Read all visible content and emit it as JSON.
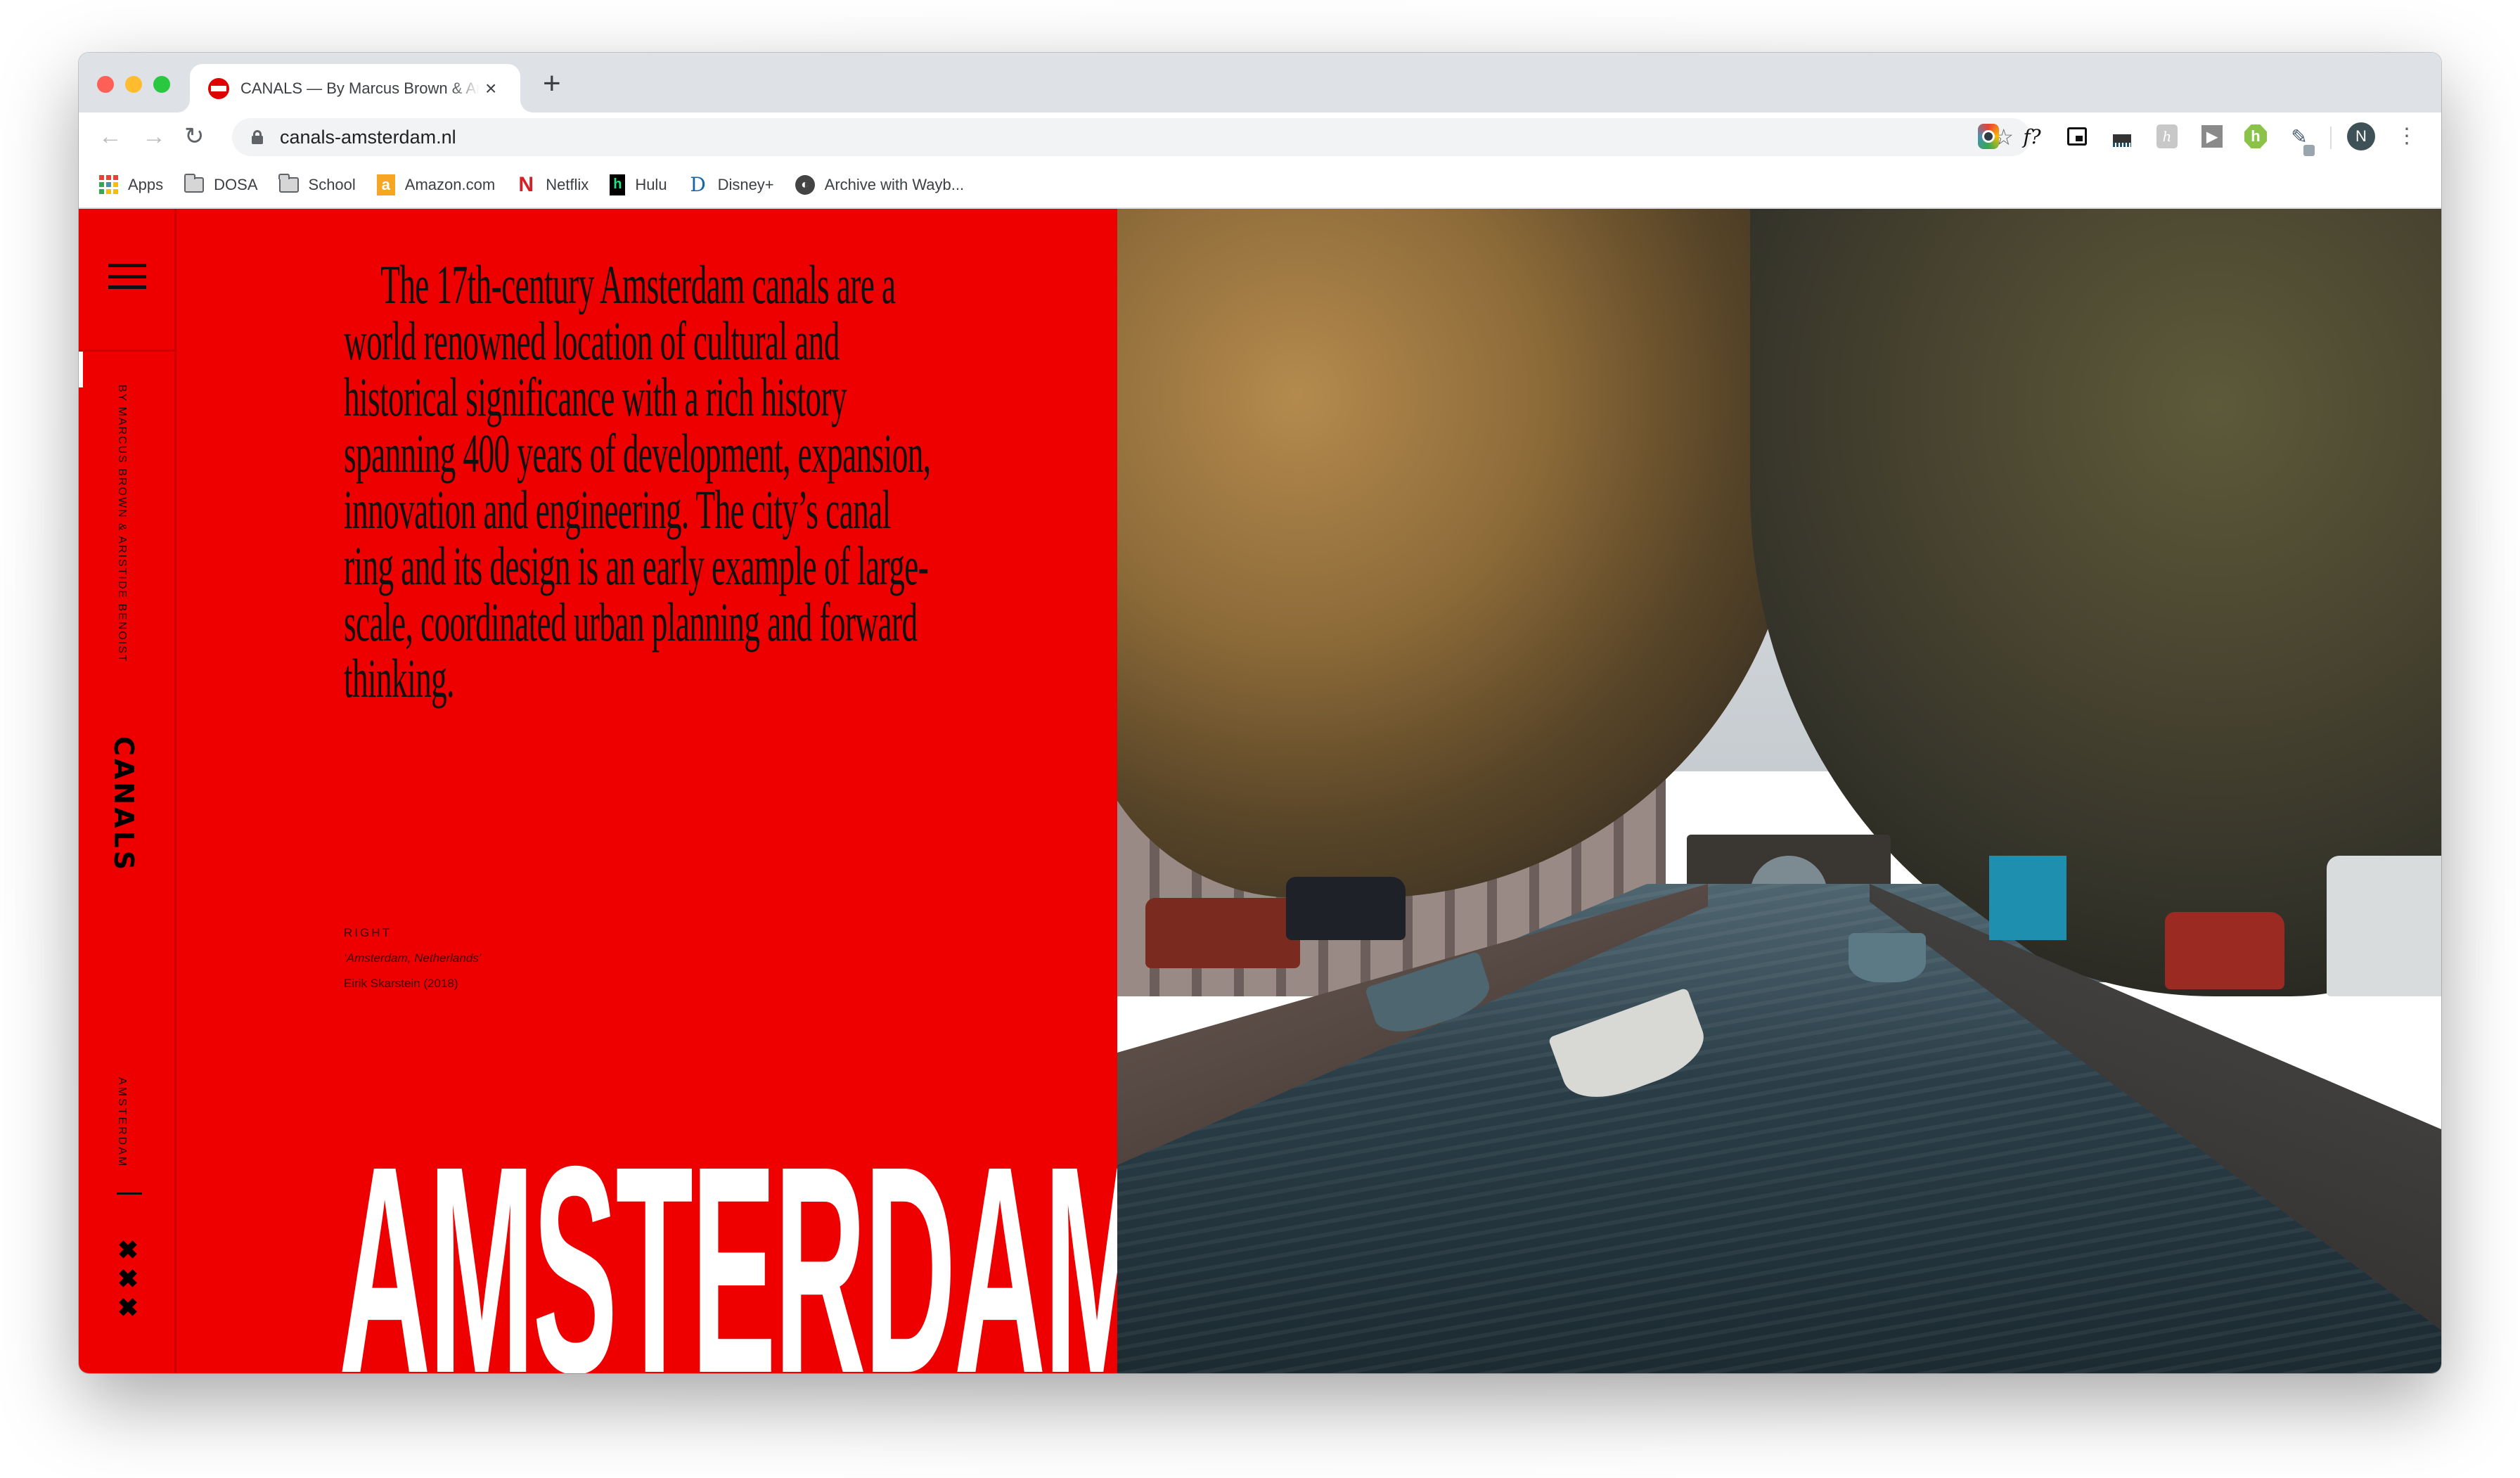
{
  "browser": {
    "tab": {
      "title": "CANALS — By Marcus Brown & Aristide Benoist",
      "close_label": "×"
    },
    "new_tab_label": "+",
    "nav": {
      "back_icon": "←",
      "forward_icon": "→",
      "reload_icon": "↻"
    },
    "address_bar": {
      "url": "canals-amsterdam.nl",
      "secure": true
    },
    "bookmark_star_icon": "☆",
    "extensions": [
      {
        "name": "camera-extension"
      },
      {
        "name": "formula-extension",
        "label": "f?"
      },
      {
        "name": "picture-in-picture-extension"
      },
      {
        "name": "code-extension"
      },
      {
        "name": "honey-extension",
        "label": "h"
      },
      {
        "name": "play-extension",
        "label": "▶"
      },
      {
        "name": "hover-extension",
        "label": "h"
      },
      {
        "name": "eyedropper-extension",
        "label": "✎"
      }
    ],
    "profile_initial": "N",
    "menu_icon": "⋮",
    "bookmarks": [
      {
        "label": "Apps",
        "icon": "apps-grid-icon"
      },
      {
        "label": "DOSA",
        "icon": "folder-icon"
      },
      {
        "label": "School",
        "icon": "folder-icon"
      },
      {
        "label": "Amazon.com",
        "icon": "amazon-icon",
        "glyph": "a"
      },
      {
        "label": "Netflix",
        "icon": "netflix-icon",
        "glyph": "N"
      },
      {
        "label": "Hulu",
        "icon": "hulu-icon",
        "glyph": "h"
      },
      {
        "label": "Disney+",
        "icon": "disney-icon",
        "glyph": "D"
      },
      {
        "label": "Archive with Wayb...",
        "icon": "wayback-icon",
        "glyph": "◐"
      }
    ]
  },
  "page": {
    "accent_color": "#ee0000",
    "sidebar": {
      "authors": "BY MARCUS BROWN & ARISTIDE BENOIST",
      "brand": "CANALS",
      "city": "AMSTERDAM",
      "crosses": [
        "✖",
        "✖",
        "✖"
      ],
      "scroll_progress": 0.035
    },
    "intro": "The 17th-century Amsterdam canals are a world renowned location of cultural and historical significance with a rich history spanning 400 years of development, expansion, innovation and engineering. The city’s canal ring and its design is an early example of large-scale, coordinated urban planning and forward thinking.",
    "credit": {
      "position": "RIGHT",
      "title": "‘Amsterdam, Netherlands’",
      "author": "Eirik Skarstein (2018)"
    },
    "headline": "AMSTERDAM",
    "photo": {
      "subject": "canal-with-boats-and-trees"
    }
  }
}
